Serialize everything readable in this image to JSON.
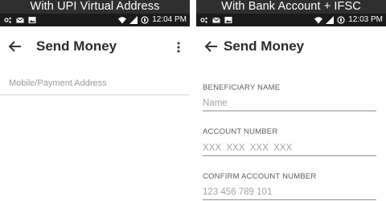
{
  "left_screen": {
    "caption": "With UPI Virtual Address",
    "status_bar": {
      "time": "12:04 PM"
    },
    "app_bar": {
      "title": "Send Money"
    },
    "form": {
      "address_placeholder": "Mobile/Payment Address"
    }
  },
  "right_screen": {
    "caption": "With Bank Account + IFSC",
    "status_bar": {
      "time": "12:03 PM"
    },
    "app_bar": {
      "title": "Send Money"
    },
    "form": {
      "beneficiary_label": "BENEFICIARY NAME",
      "beneficiary_placeholder": "Name",
      "account_label": "ACCOUNT NUMBER",
      "account_placeholder": "XXX  XXX  XXX  XXX",
      "confirm_label": "CONFIRM ACCOUNT NUMBER",
      "confirm_placeholder": "123 456 789 101"
    }
  },
  "icons": [
    "back-arrow-icon",
    "overflow-menu-icon",
    "wifi-icon",
    "signal-icon",
    "battery-icon",
    "notification-icon"
  ],
  "colors": {
    "caption_bg": "#2f2f2f",
    "status_bar_bg": "#1b1b1b",
    "title_text": "#2b2b2b"
  }
}
